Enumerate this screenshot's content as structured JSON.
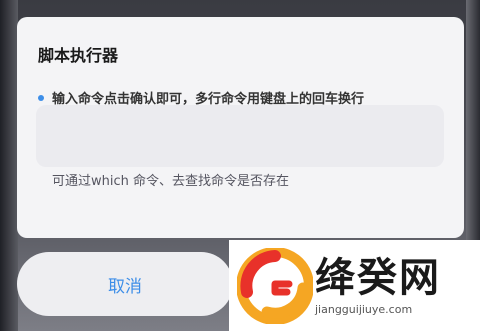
{
  "dialog": {
    "title": "脚本执行器",
    "hint": "输入命令点击确认即可，多行命令用键盘上的回车换行",
    "input_value": "",
    "tip": "可通过which 命令、去查找命令是否存在"
  },
  "actions": {
    "cancel_label": "取消"
  },
  "watermark": {
    "title": "绛癸网",
    "url": "jiangguijiuye.com"
  },
  "colors": {
    "accent": "#3d8ee8",
    "dialog_bg": "#f4f4f6",
    "input_bg": "#ebebef"
  }
}
